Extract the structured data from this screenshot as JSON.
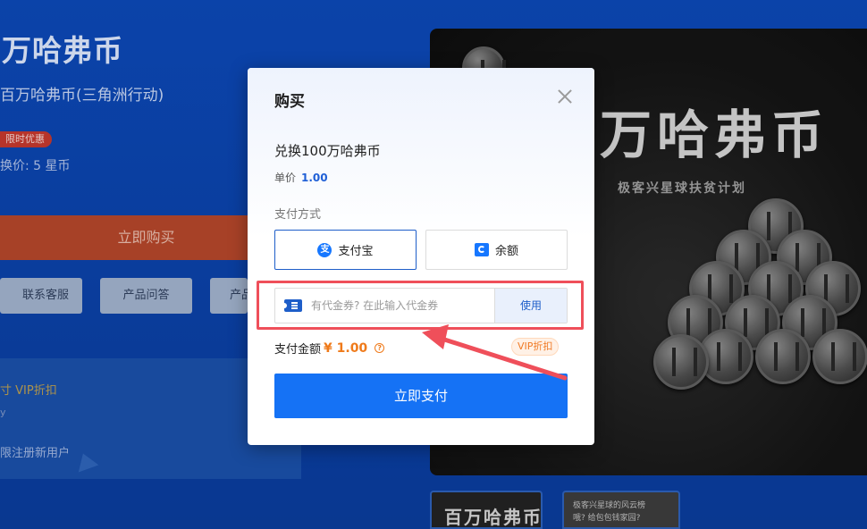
{
  "background": {
    "title": "万哈弗币",
    "subtitle": "百万哈弗币(三角洲行动)",
    "badge": "限时优惠",
    "price": "换价: 5 星币",
    "buy_button": "立即购买",
    "buttons": [
      "联系客服",
      "产品问答",
      "产品"
    ],
    "vip_text": "寸 VIP折扣",
    "dot_text": "y",
    "new_user_text": "限注册新用户",
    "hero_title": "万哈弗币",
    "hero_subtitle": "极客兴星球扶贫计划",
    "thumb1_text": "百万哈弗币",
    "thumb2_text": [
      "极客兴星球的风云榜",
      "哦? 给包包钱家园?"
    ]
  },
  "modal": {
    "title": "购买",
    "product": "兑换100万哈弗币",
    "unit_label": "单价",
    "unit_value": "1.00",
    "pay_method_label": "支付方式",
    "pay_options": [
      {
        "label": "支付宝",
        "icon": "alipay-icon",
        "selected": true
      },
      {
        "label": "余额",
        "icon": "balance-icon",
        "selected": false
      }
    ],
    "coupon": {
      "placeholder": "有代金券? 在此输入代金券",
      "value": "",
      "use_button": "使用"
    },
    "amount_label": "支付金额",
    "amount_value": "¥ 1.00",
    "vip_badge": "VIP折扣",
    "pay_button": "立即支付"
  },
  "colors": {
    "primary": "#1572f5",
    "accent_orange": "#ef7a1a",
    "highlight_red": "#ef4f5a",
    "page_bg": "#0b3f9e"
  }
}
